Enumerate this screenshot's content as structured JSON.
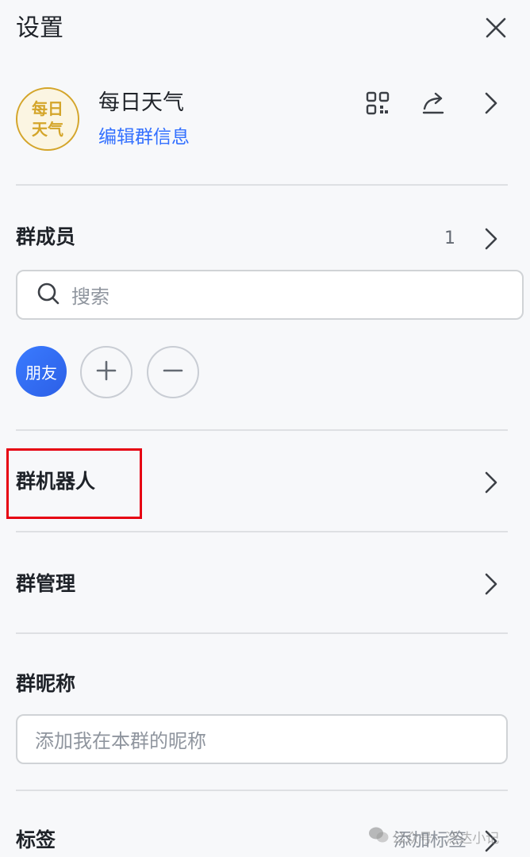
{
  "header": {
    "title": "设置"
  },
  "group": {
    "avatar_line1": "每日",
    "avatar_line2": "天气",
    "name": "每日天气",
    "edit_label": "编辑群信息"
  },
  "members": {
    "title": "群成员",
    "count": "1",
    "search_placeholder": "搜索",
    "member_avatar_label": "朋友"
  },
  "bots": {
    "title": "群机器人"
  },
  "management": {
    "title": "群管理"
  },
  "nickname": {
    "title": "群昵称",
    "placeholder": "添加我在本群的昵称"
  },
  "tags": {
    "title": "标签",
    "add_label": "添加标签"
  },
  "watermark": {
    "text": "公众号 · 泛达小记"
  },
  "colors": {
    "accent": "#3370ff",
    "highlight": "#e60012",
    "avatar_gold": "#d4a52a"
  },
  "icons": [
    "close-icon",
    "qrcode-icon",
    "share-icon",
    "chevron-right-icon",
    "search-icon",
    "plus-icon",
    "minus-icon",
    "wechat-icon"
  ]
}
